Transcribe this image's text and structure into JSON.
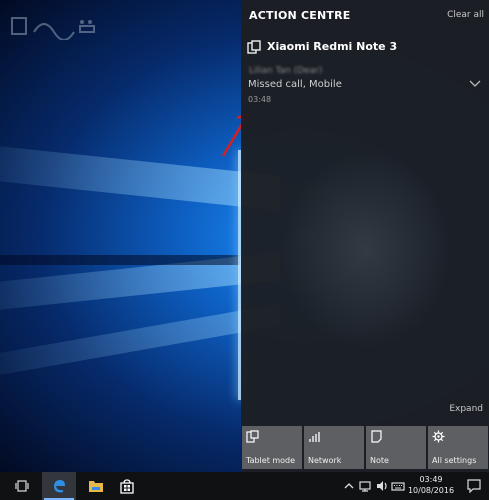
{
  "action_centre": {
    "title": "ACTION CENTRE",
    "clear_all": "Clear all",
    "app_name": "Xiaomi Redmi Note 3",
    "notification": {
      "sender": "Lilian Tan (Dear)",
      "body": "Missed call, Mobile",
      "time": "03:48"
    },
    "expand": "Expand",
    "tiles": [
      {
        "label": "Tablet mode",
        "icon": "tablet-mode-icon"
      },
      {
        "label": "Network",
        "icon": "network-icon"
      },
      {
        "label": "Note",
        "icon": "note-icon"
      },
      {
        "label": "All settings",
        "icon": "gear-icon"
      }
    ]
  },
  "taskbar": {
    "time": "03:49",
    "date": "10/08/2016",
    "items": [
      "task-view-icon",
      "edge-icon",
      "file-explorer-icon",
      "store-icon"
    ],
    "tray_icons": [
      "chevron-up-icon",
      "network-icon",
      "volume-icon",
      "keyboard-icon",
      "action-centre-icon"
    ]
  },
  "colors": {
    "action_centre_bg": "#1c1e22",
    "tile_bg": "#5d5f62",
    "accent": "#1e90ff",
    "annotation_arrow": "#d42020"
  }
}
